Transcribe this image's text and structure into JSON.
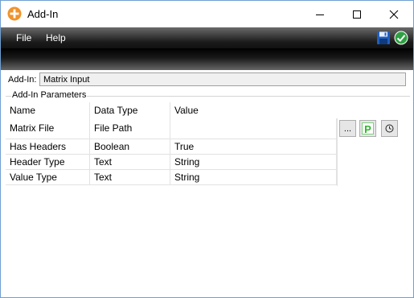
{
  "window": {
    "title": "Add-In",
    "controls": {
      "minimize": "minimize",
      "maximize": "maximize",
      "close": "close"
    }
  },
  "menu": {
    "items": [
      {
        "label": "File"
      },
      {
        "label": "Help"
      }
    ],
    "icons": [
      "save-icon",
      "check-circle-icon"
    ]
  },
  "addin": {
    "label": "Add-In:",
    "value": "Matrix Input"
  },
  "parameters": {
    "group_title": "Add-In Parameters",
    "columns": [
      "Name",
      "Data Type",
      "Value"
    ],
    "rows": [
      {
        "name": "Matrix File",
        "type": "File Path",
        "value": ""
      },
      {
        "name": "Has Headers",
        "type": "Boolean",
        "value": "True"
      },
      {
        "name": "Header Type",
        "type": "Text",
        "value": "String"
      },
      {
        "name": "Value Type",
        "type": "Text",
        "value": "String"
      }
    ]
  },
  "side_buttons": {
    "browse_label": "...",
    "p_label": "P"
  },
  "colors": {
    "accent_orange": "#f0932b",
    "save_blue": "#1f5fbf",
    "ok_green": "#2ea043",
    "p_green": "#2fb52f"
  }
}
